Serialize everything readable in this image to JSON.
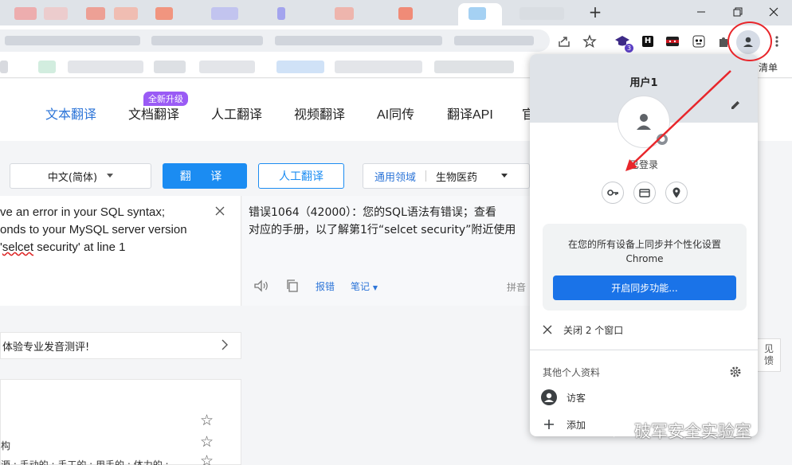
{
  "window": {
    "new_tab": "+",
    "minimize": "—",
    "maximize": "❐",
    "close": "✕"
  },
  "toolbar": {
    "extension_badge": "3",
    "ext_h": "H"
  },
  "bookmarks": {
    "right_label": "清单"
  },
  "site": {
    "nav": [
      "文本翻译",
      "文档翻译",
      "人工翻译",
      "视频翻译",
      "AI同传",
      "翻译API",
      "官"
    ],
    "badge": "全新升级",
    "source_lang": "中文(简体)",
    "translate_button": "翻 译",
    "human_button": "人工翻译",
    "domain_label": "通用领域",
    "domain_value": "生物医药"
  },
  "source": {
    "line1": "ve an error in your SQL syntax;",
    "line2": "onds to your MySQL server version",
    "line3_pre": "'",
    "line3_sq": "selcet",
    "line3_post": " security' at line 1"
  },
  "target": {
    "line1": "错误1064（42000）：您的SQL语法有错误；查看",
    "line2": "对应的手册，以了解第1行“selcet security”附近使用",
    "report": "报错",
    "notes": "笔记",
    "pinyin": "拼音"
  },
  "promo": {
    "text": "体验专业发音测评!"
  },
  "dict": {
    "line1": "构",
    "line2": "源 ; 手动的 ; 手工的 ; 用手的 ; 体力的 ;"
  },
  "feedback": {
    "line1": "见",
    "line2": "馈"
  },
  "popup": {
    "user": "用户1",
    "status": "已登录",
    "sync_line1": "在您的所有设备上同步并个性化设置",
    "sync_line2": "Chrome",
    "sync_button": "开启同步功能...",
    "close_windows": "关闭 2 个窗口",
    "other_profiles": "其他个人资料",
    "guest": "访客",
    "add": "添加"
  },
  "watermark": {
    "text": "破军安全实验室"
  },
  "colors": {
    "accent": "#1a73e8",
    "annotation": "#e8262b",
    "site_blue": "#1b8cf2"
  }
}
